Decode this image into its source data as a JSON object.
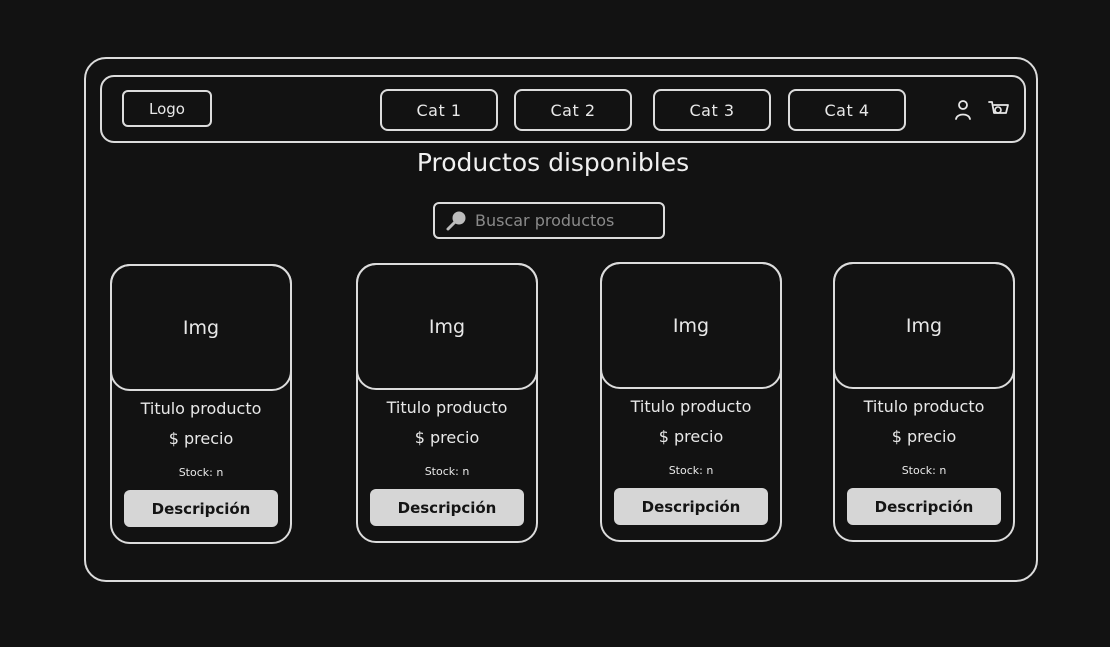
{
  "navbar": {
    "logo": "Logo",
    "categories": [
      "Cat 1",
      "Cat 2",
      "Cat 3",
      "Cat 4"
    ],
    "icons": [
      "user-icon",
      "cart-icon"
    ]
  },
  "main": {
    "title": "Productos disponibles",
    "search": {
      "placeholder": "Buscar productos",
      "icon": "search-icon"
    },
    "products": [
      {
        "image": "Img",
        "title": "Titulo producto",
        "price": "$ precio",
        "stock": "Stock: n",
        "button": "Descripción"
      },
      {
        "image": "Img",
        "title": "Titulo producto",
        "price": "$ precio",
        "stock": "Stock: n",
        "button": "Descripción"
      },
      {
        "image": "Img",
        "title": "Titulo producto",
        "price": "$ precio",
        "stock": "Stock: n",
        "button": "Descripción"
      },
      {
        "image": "Img",
        "title": "Titulo producto",
        "price": "$ precio",
        "stock": "Stock: n",
        "button": "Descripción"
      }
    ]
  },
  "colors": {
    "background": "#121212",
    "stroke": "#dcdcdc",
    "button_fill": "#d6d6d6",
    "button_text": "#141414",
    "placeholder": "#8a8a8a"
  }
}
